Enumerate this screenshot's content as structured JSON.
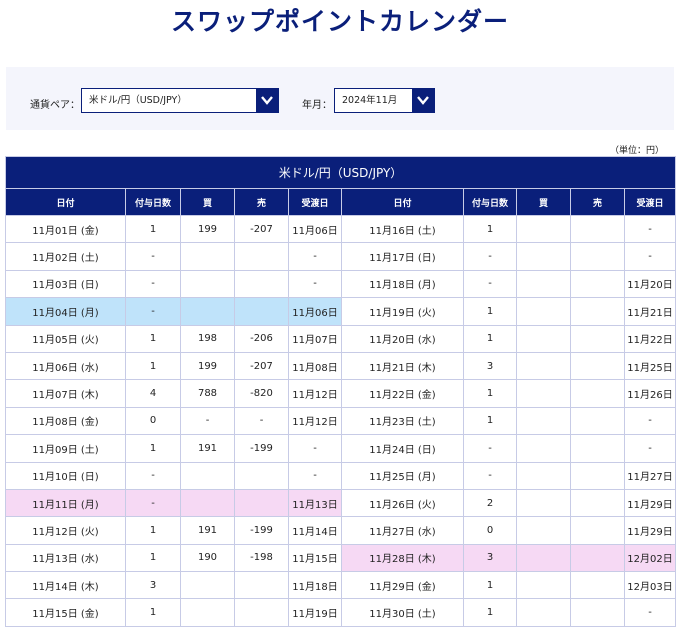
{
  "page": {
    "title": "スワップポイントカレンダー",
    "unit_note": "（単位：円）"
  },
  "filters": {
    "pair_label": "通貨ペア：",
    "pair_value": "米ドル/円（USD/JPY）",
    "month_label": "年月：",
    "month_value": "2024年11月"
  },
  "table": {
    "pair_title": "米ドル/円（USD/JPY）",
    "headers": [
      "日付",
      "付与日数",
      "買",
      "売",
      "受渡日"
    ],
    "left_rows": [
      {
        "date": "11月01日 (金)",
        "type": "weekday",
        "days": "1",
        "buy": "199",
        "sell": "-207",
        "recv": "11月06日"
      },
      {
        "date": "11月02日 (土)",
        "type": "sat",
        "days": "-",
        "buy": "",
        "sell": "",
        "recv": "-"
      },
      {
        "date": "11月03日 (日)",
        "type": "sun",
        "days": "-",
        "buy": "",
        "sell": "",
        "recv": "-"
      },
      {
        "date": "11月04日 (月)",
        "type": "weekday",
        "days": "-",
        "buy": "",
        "sell": "",
        "recv": "11月06日",
        "hl": "blue"
      },
      {
        "date": "11月05日 (火)",
        "type": "weekday",
        "days": "1",
        "buy": "198",
        "sell": "-206",
        "recv": "11月07日"
      },
      {
        "date": "11月06日 (水)",
        "type": "weekday",
        "days": "1",
        "buy": "199",
        "sell": "-207",
        "recv": "11月08日"
      },
      {
        "date": "11月07日 (木)",
        "type": "weekday",
        "days": "4",
        "buy": "788",
        "sell": "-820",
        "recv": "11月12日"
      },
      {
        "date": "11月08日 (金)",
        "type": "weekday",
        "days": "0",
        "buy": "-",
        "sell": "-",
        "recv": "11月12日"
      },
      {
        "date": "11月09日 (土)",
        "type": "sat",
        "days": "1",
        "buy": "191",
        "sell": "-199",
        "recv": "-"
      },
      {
        "date": "11月10日 (日)",
        "type": "sun",
        "days": "-",
        "buy": "",
        "sell": "",
        "recv": "-"
      },
      {
        "date": "11月11日 (月)",
        "type": "weekday",
        "days": "-",
        "buy": "",
        "sell": "",
        "recv": "11月13日",
        "hl": "pink"
      },
      {
        "date": "11月12日 (火)",
        "type": "weekday",
        "days": "1",
        "buy": "191",
        "sell": "-199",
        "recv": "11月14日"
      },
      {
        "date": "11月13日 (水)",
        "type": "weekday",
        "days": "1",
        "buy": "190",
        "sell": "-198",
        "recv": "11月15日"
      },
      {
        "date": "11月14日 (木)",
        "type": "weekday",
        "days": "3",
        "buy": "",
        "sell": "",
        "recv": "11月18日"
      },
      {
        "date": "11月15日 (金)",
        "type": "weekday",
        "days": "1",
        "buy": "",
        "sell": "",
        "recv": "11月19日"
      }
    ],
    "right_rows": [
      {
        "date": "11月16日 (土)",
        "type": "sat",
        "days": "1",
        "buy": "",
        "sell": "",
        "recv": "-"
      },
      {
        "date": "11月17日 (日)",
        "type": "sun",
        "days": "-",
        "buy": "",
        "sell": "",
        "recv": "-"
      },
      {
        "date": "11月18日 (月)",
        "type": "weekday",
        "days": "-",
        "buy": "",
        "sell": "",
        "recv": "11月20日"
      },
      {
        "date": "11月19日 (火)",
        "type": "weekday",
        "days": "1",
        "buy": "",
        "sell": "",
        "recv": "11月21日"
      },
      {
        "date": "11月20日 (水)",
        "type": "weekday",
        "days": "1",
        "buy": "",
        "sell": "",
        "recv": "11月22日"
      },
      {
        "date": "11月21日 (木)",
        "type": "weekday",
        "days": "3",
        "buy": "",
        "sell": "",
        "recv": "11月25日"
      },
      {
        "date": "11月22日 (金)",
        "type": "weekday",
        "days": "1",
        "buy": "",
        "sell": "",
        "recv": "11月26日"
      },
      {
        "date": "11月23日 (土)",
        "type": "sat",
        "days": "1",
        "buy": "",
        "sell": "",
        "recv": "-"
      },
      {
        "date": "11月24日 (日)",
        "type": "sun",
        "days": "-",
        "buy": "",
        "sell": "",
        "recv": "-"
      },
      {
        "date": "11月25日 (月)",
        "type": "weekday",
        "days": "-",
        "buy": "",
        "sell": "",
        "recv": "11月27日"
      },
      {
        "date": "11月26日 (火)",
        "type": "weekday",
        "days": "2",
        "buy": "",
        "sell": "",
        "recv": "11月29日"
      },
      {
        "date": "11月27日 (水)",
        "type": "weekday",
        "days": "0",
        "buy": "",
        "sell": "",
        "recv": "11月29日"
      },
      {
        "date": "11月28日 (木)",
        "type": "weekday",
        "days": "3",
        "buy": "",
        "sell": "",
        "recv": "12月02日",
        "hl": "pink"
      },
      {
        "date": "11月29日 (金)",
        "type": "weekday",
        "days": "1",
        "buy": "",
        "sell": "",
        "recv": "12月03日"
      },
      {
        "date": "11月30日 (土)",
        "type": "sat",
        "days": "1",
        "buy": "",
        "sell": "",
        "recv": "-"
      }
    ]
  },
  "colors": {
    "brand_navy": "#0a1f7a",
    "saturday_blue": "#1f2ec9",
    "sunday_red": "#d32020",
    "highlight_blue": "#bfe3fa",
    "highlight_pink": "#f6d9f4"
  },
  "icons": {
    "dropdown": "chevron-down-icon"
  }
}
